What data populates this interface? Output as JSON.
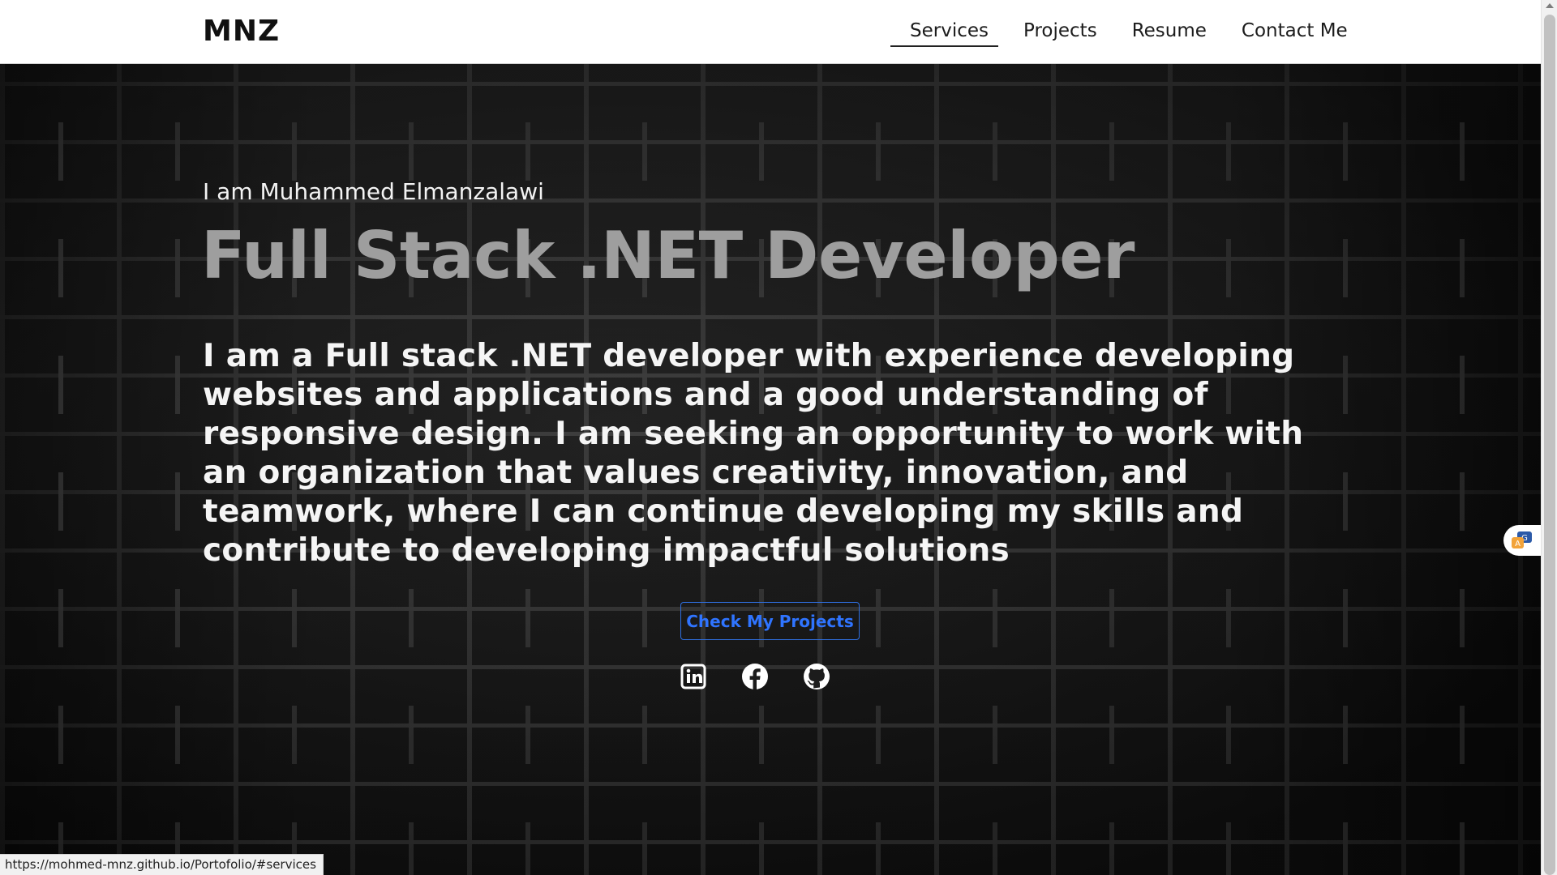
{
  "header": {
    "brand": "MNZ",
    "nav": [
      {
        "label": "Services"
      },
      {
        "label": "Projects"
      },
      {
        "label": "Resume"
      },
      {
        "label": "Contact Me"
      }
    ]
  },
  "hero": {
    "intro": "I am Muhammed Elmanzalawi",
    "headline": "Full Stack .NET Developer",
    "bio": "I am a Full stack .NET developer with experience developing websites and applications and a good understanding of responsive design. I am seeking an opportunity to work with an organization that values creativity, innovation, and teamwork, where I can continue developing my skills and contribute to developing impactful solutions",
    "cta_label": "Check My Projects",
    "socials": [
      {
        "icon": "linkedin-icon"
      },
      {
        "icon": "facebook-icon"
      },
      {
        "icon": "github-icon"
      }
    ]
  },
  "status_bar": {
    "url": "https://mohmed-mnz.github.io/Portofolio/#services"
  },
  "colors": {
    "headline": "#9e9e9e",
    "cta": "#2f74ff",
    "header_bg": "#ffffff"
  }
}
